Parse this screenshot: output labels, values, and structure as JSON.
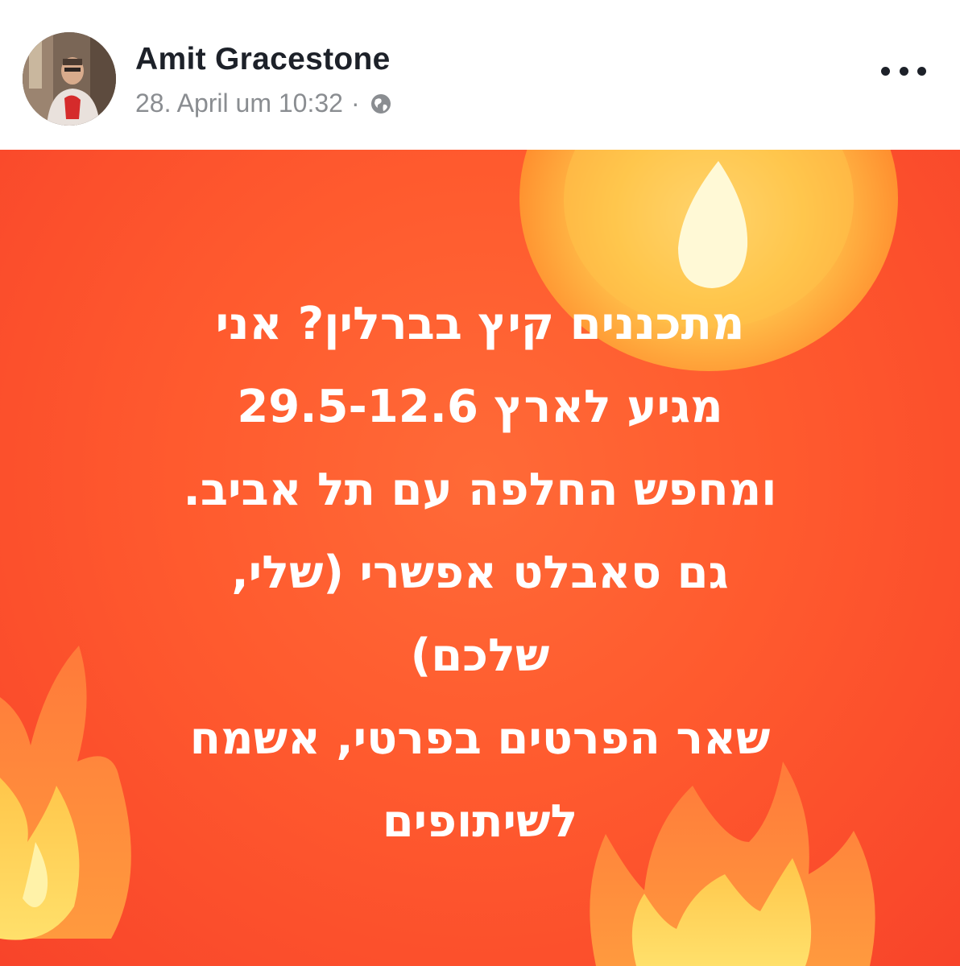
{
  "post": {
    "author": "Amit Gracestone",
    "timestamp": "28. April um 10:32",
    "separator": "·",
    "privacy_icon": "globe-icon",
    "more_icon": "more-horizontal-icon"
  },
  "image": {
    "background_color": "#ff5a2e",
    "flame_icon": "fire-emoji",
    "text_lines": [
      "מתכננים קיץ בברלין? אני",
      "מגיע לארץ 29.5-12.6",
      "ומחפש החלפה עם תל אביב.",
      "גם סאבלט אפשרי (שלי,",
      "שלכם)",
      "שאר הפרטים בפרטי, אשמח",
      "לשיתופים"
    ]
  }
}
